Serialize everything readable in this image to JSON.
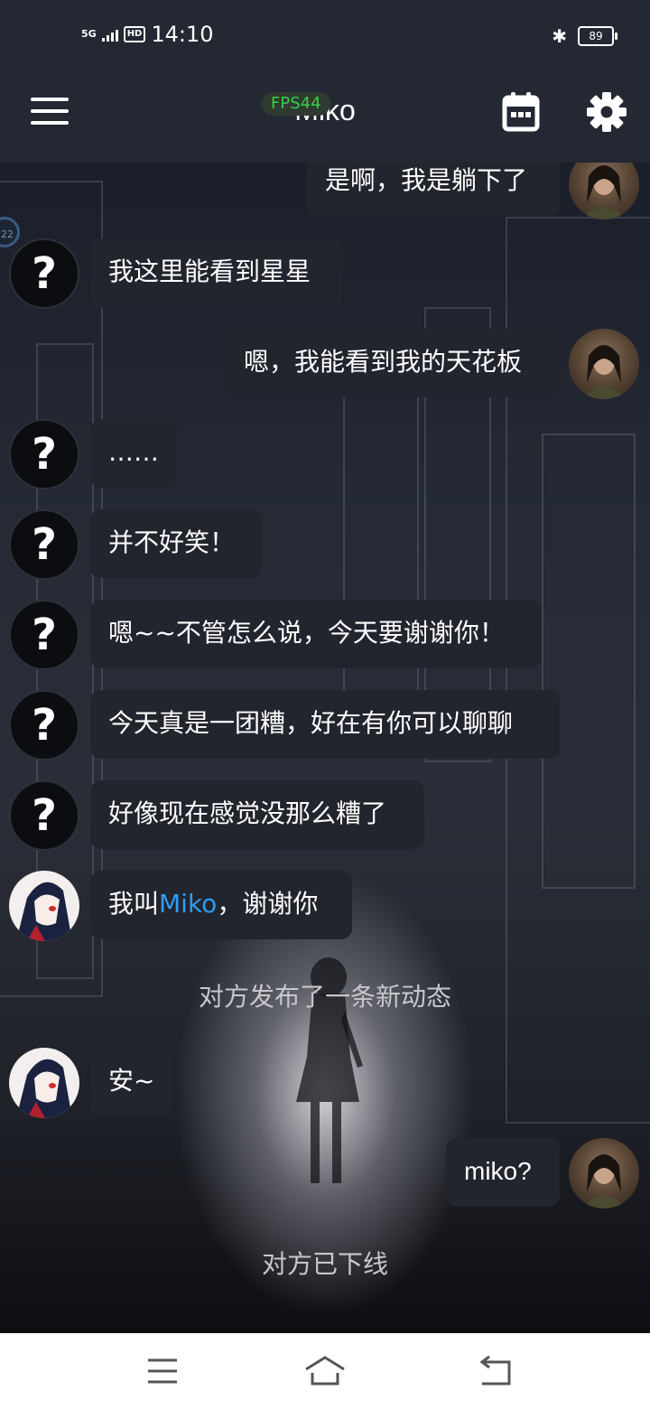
{
  "status_bar": {
    "network": "5G",
    "hd": "HD",
    "time": "14:10",
    "battery": "89"
  },
  "app_bar": {
    "fps": "FPS44",
    "title": "Miko"
  },
  "chat": {
    "badge": "22",
    "messages": [
      {
        "side": "right",
        "avatar": "user",
        "text": "是啊，我是躺下了"
      },
      {
        "side": "left",
        "avatar": "unknown",
        "text": "我这里能看到星星"
      },
      {
        "side": "right",
        "avatar": "user",
        "text": "嗯，我能看到我的天花板"
      },
      {
        "side": "left",
        "avatar": "unknown",
        "text": "……"
      },
      {
        "side": "left",
        "avatar": "unknown",
        "text": "并不好笑！"
      },
      {
        "side": "left",
        "avatar": "unknown",
        "text": "嗯~~不管怎么说，今天要谢谢你！"
      },
      {
        "side": "left",
        "avatar": "unknown",
        "text": "今天真是一团糟，好在有你可以聊聊"
      },
      {
        "side": "left",
        "avatar": "unknown",
        "text": "好像现在感觉没那么糟了"
      },
      {
        "side": "left",
        "avatar": "miko",
        "text_before": "我叫",
        "text_link": "Miko",
        "text_after": "，谢谢你"
      },
      {
        "side": "left",
        "avatar": "miko",
        "text": "安~"
      },
      {
        "side": "right",
        "avatar": "user",
        "text": "miko?"
      }
    ],
    "system": {
      "new_post": "对方发布了一条新动态",
      "offline": "对方已下线"
    },
    "unknown_avatar_glyph": "?"
  },
  "icons": {
    "menu": "menu-icon",
    "calendar": "calendar-icon",
    "settings": "gear-icon",
    "nav_menu": "nav-menu-icon",
    "nav_home": "nav-home-icon",
    "nav_back": "nav-back-icon"
  }
}
